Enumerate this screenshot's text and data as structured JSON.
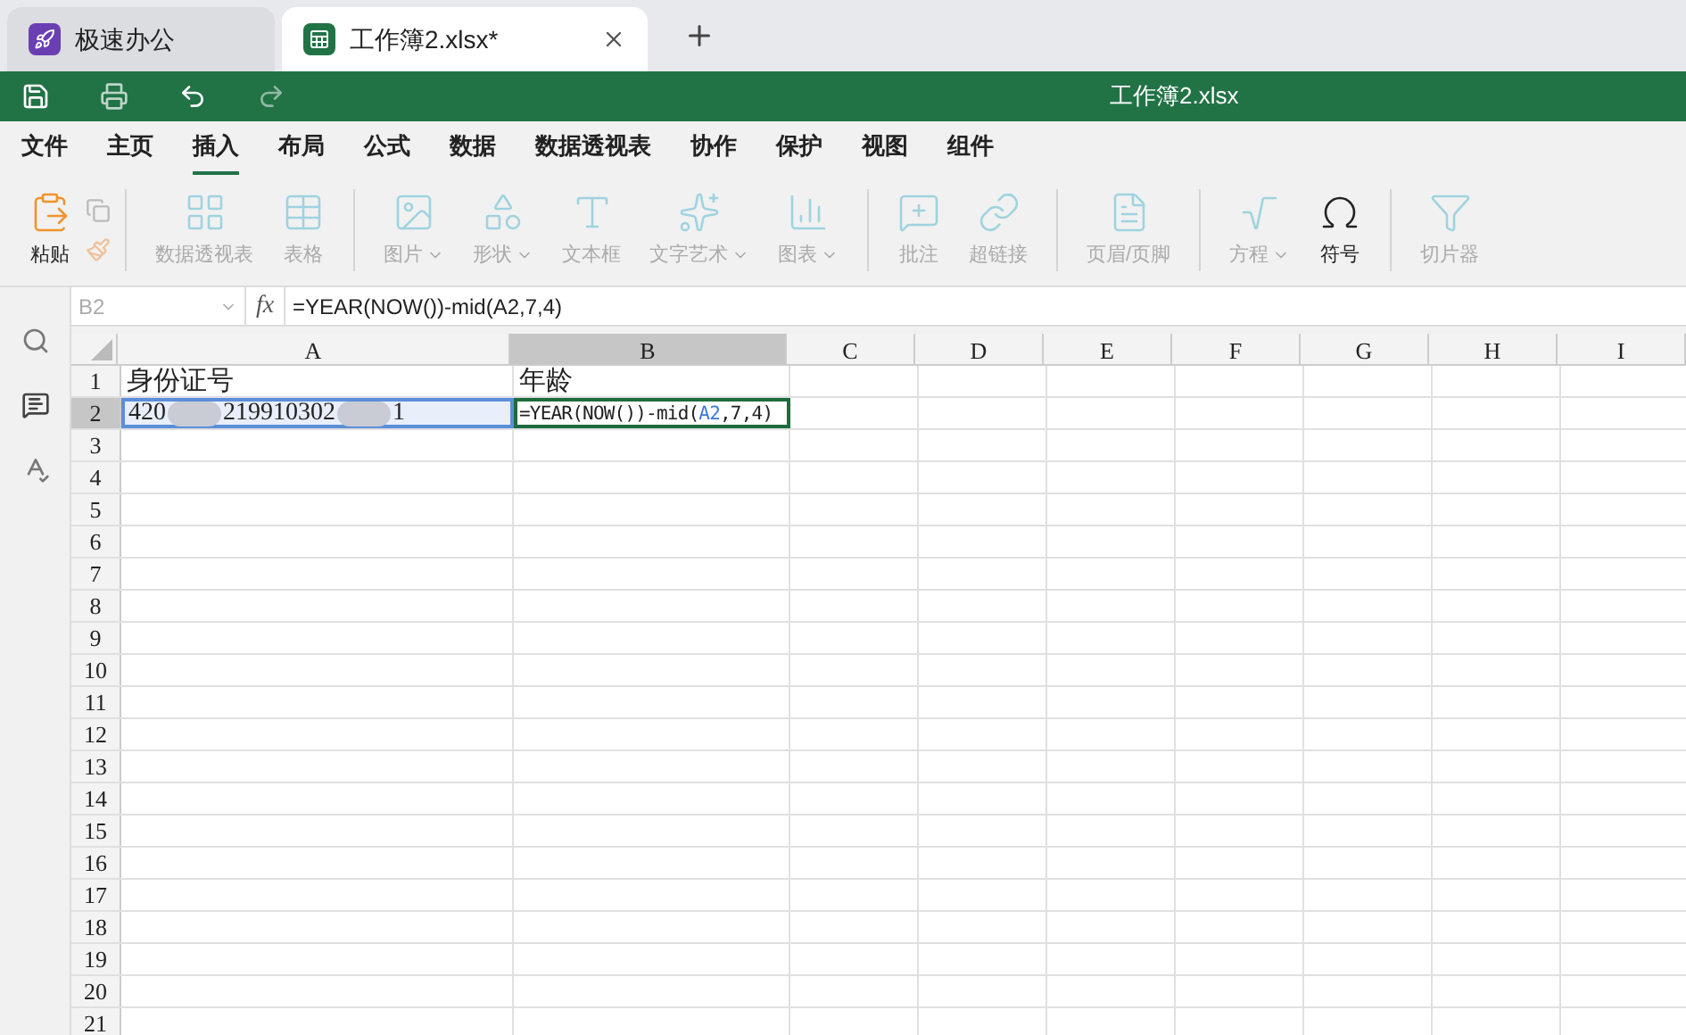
{
  "browser_tabs": [
    {
      "kind": "app",
      "label": "极速办公",
      "selected": false
    },
    {
      "kind": "sheet",
      "label": "工作簿2.xlsx*",
      "selected": true
    }
  ],
  "title_bar": {
    "title": "工作簿2.xlsx"
  },
  "menu": [
    {
      "label": "文件",
      "selected": false
    },
    {
      "label": "主页",
      "selected": false
    },
    {
      "label": "插入",
      "selected": true
    },
    {
      "label": "布局",
      "selected": false
    },
    {
      "label": "公式",
      "selected": false
    },
    {
      "label": "数据",
      "selected": false
    },
    {
      "label": "数据透视表",
      "selected": false
    },
    {
      "label": "协作",
      "selected": false
    },
    {
      "label": "保护",
      "selected": false
    },
    {
      "label": "视图",
      "selected": false
    },
    {
      "label": "组件",
      "selected": false
    }
  ],
  "ribbon": [
    {
      "kind": "paste",
      "label": "粘贴",
      "disabled": false,
      "dropdown": false
    },
    {
      "kind": "pivot",
      "label": "数据透视表",
      "disabled": true,
      "dropdown": false
    },
    {
      "kind": "table",
      "label": "表格",
      "disabled": true,
      "dropdown": false
    },
    {
      "kind": "image",
      "label": "图片",
      "disabled": true,
      "dropdown": true
    },
    {
      "kind": "shape",
      "label": "形状",
      "disabled": true,
      "dropdown": true
    },
    {
      "kind": "textbox",
      "label": "文本框",
      "disabled": true,
      "dropdown": false
    },
    {
      "kind": "wordart",
      "label": "文字艺术",
      "disabled": true,
      "dropdown": true
    },
    {
      "kind": "chart",
      "label": "图表",
      "disabled": true,
      "dropdown": true
    },
    {
      "kind": "comment",
      "label": "批注",
      "disabled": true,
      "dropdown": false
    },
    {
      "kind": "link",
      "label": "超链接",
      "disabled": true,
      "dropdown": false
    },
    {
      "kind": "header",
      "label": "页眉/页脚",
      "disabled": true,
      "dropdown": false
    },
    {
      "kind": "equation",
      "label": "方程",
      "disabled": true,
      "dropdown": true
    },
    {
      "kind": "symbol",
      "label": "符号",
      "disabled": false,
      "dropdown": false
    },
    {
      "kind": "slicer",
      "label": "切片器",
      "disabled": true,
      "dropdown": false
    }
  ],
  "formula_bar": {
    "cell_ref": "B2",
    "fx_label": "fx",
    "formula": "=YEAR(NOW())-mid(A2,7,4)"
  },
  "sheet": {
    "columns": [
      {
        "label": "A",
        "selected": false
      },
      {
        "label": "B",
        "selected": true
      },
      {
        "label": "C",
        "selected": false
      },
      {
        "label": "D",
        "selected": false
      },
      {
        "label": "E",
        "selected": false
      },
      {
        "label": "F",
        "selected": false
      },
      {
        "label": "G",
        "selected": false
      },
      {
        "label": "H",
        "selected": false
      },
      {
        "label": "I",
        "selected": false
      }
    ],
    "rows": [
      {
        "label": "1",
        "selected": false,
        "cells": [
          {
            "text": "身份证号"
          },
          {
            "text": "年龄"
          }
        ]
      },
      {
        "label": "2",
        "selected": true,
        "cells": [
          {
            "parts": [
              "420",
              "219910302",
              "1"
            ],
            "referenced": true
          },
          {
            "formula_parts": [
              "=YEAR(NOW())-mid(",
              "A2",
              ",7,4)"
            ],
            "editing": true
          }
        ]
      },
      {
        "label": "3",
        "selected": false
      },
      {
        "label": "4",
        "selected": false
      },
      {
        "label": "5",
        "selected": false
      },
      {
        "label": "6",
        "selected": false
      },
      {
        "label": "7",
        "selected": false
      },
      {
        "label": "8",
        "selected": false
      },
      {
        "label": "9",
        "selected": false
      },
      {
        "label": "10",
        "selected": false
      },
      {
        "label": "11",
        "selected": false
      },
      {
        "label": "12",
        "selected": false
      },
      {
        "label": "13",
        "selected": false
      },
      {
        "label": "14",
        "selected": false
      },
      {
        "label": "15",
        "selected": false
      },
      {
        "label": "16",
        "selected": false
      },
      {
        "label": "17",
        "selected": false
      },
      {
        "label": "18",
        "selected": false
      },
      {
        "label": "19",
        "selected": false
      },
      {
        "label": "20",
        "selected": false
      },
      {
        "label": "21",
        "selected": false
      }
    ]
  }
}
